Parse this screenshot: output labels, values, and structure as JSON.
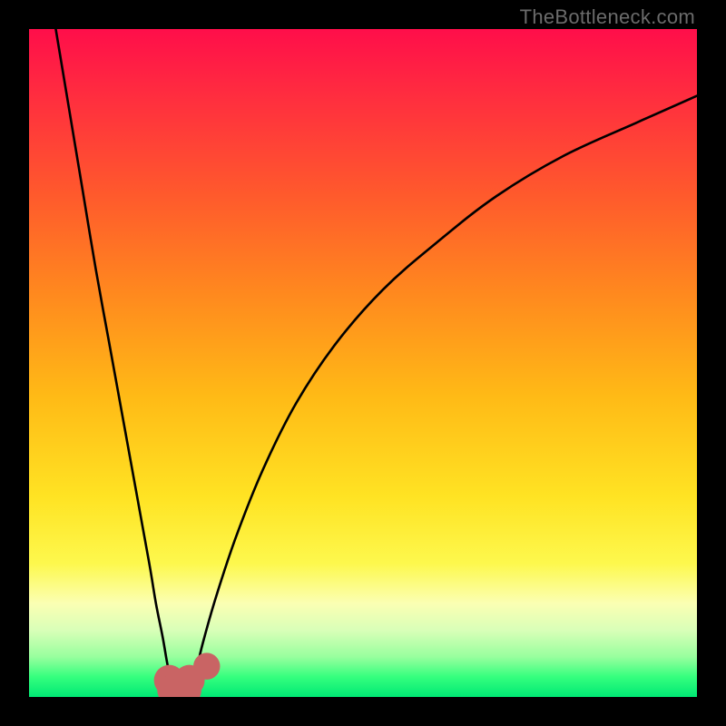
{
  "watermark": "TheBottleneck.com",
  "colors": {
    "frame": "#000000",
    "watermark": "#6b6b6b",
    "gradient_stops": [
      {
        "pos": 0.0,
        "color": "#ff0e4a"
      },
      {
        "pos": 0.1,
        "color": "#ff2d3f"
      },
      {
        "pos": 0.25,
        "color": "#ff5a2c"
      },
      {
        "pos": 0.4,
        "color": "#ff8a1e"
      },
      {
        "pos": 0.55,
        "color": "#ffba16"
      },
      {
        "pos": 0.7,
        "color": "#ffe323"
      },
      {
        "pos": 0.8,
        "color": "#fdf84d"
      },
      {
        "pos": 0.86,
        "color": "#fbffb3"
      },
      {
        "pos": 0.9,
        "color": "#d9ffb8"
      },
      {
        "pos": 0.94,
        "color": "#98ff9e"
      },
      {
        "pos": 0.97,
        "color": "#35ff7e"
      },
      {
        "pos": 1.0,
        "color": "#00e874"
      }
    ],
    "curve": "#000000",
    "marker_fill": "#c96464",
    "marker_stroke": "#c96464"
  },
  "chart_data": {
    "type": "line",
    "title": "",
    "xlabel": "",
    "ylabel": "",
    "xlim": [
      0,
      100
    ],
    "ylim": [
      0,
      100
    ],
    "series": [
      {
        "name": "left-branch",
        "x": [
          4,
          6,
          8,
          10,
          12,
          14,
          16,
          18,
          19,
          20,
          20.7,
          21.3,
          22.0
        ],
        "y": [
          100,
          88,
          76,
          64,
          53,
          42,
          31,
          20,
          14,
          9,
          5,
          2.5,
          0.8
        ]
      },
      {
        "name": "right-branch",
        "x": [
          24.0,
          24.8,
          26,
          28,
          31,
          35,
          40,
          46,
          53,
          61,
          70,
          80,
          91,
          100
        ],
        "y": [
          0.8,
          3,
          8,
          15,
          24,
          34,
          44,
          53,
          61,
          68,
          75,
          81,
          86,
          90
        ]
      }
    ],
    "markers": [
      {
        "x": 21.0,
        "y": 2.5,
        "r": 2.3
      },
      {
        "x": 21.5,
        "y": 1.0,
        "r": 2.3
      },
      {
        "x": 22.5,
        "y": 0.6,
        "r": 2.3
      },
      {
        "x": 23.5,
        "y": 1.0,
        "r": 2.3
      },
      {
        "x": 24.0,
        "y": 2.5,
        "r": 2.3
      },
      {
        "x": 26.6,
        "y": 4.6,
        "r": 2.0
      }
    ]
  }
}
